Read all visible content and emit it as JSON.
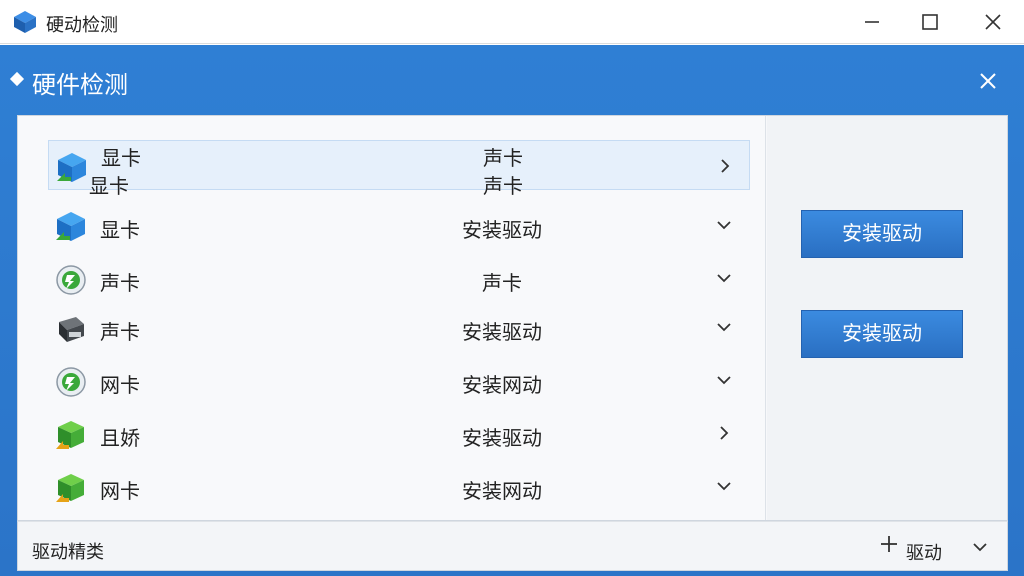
{
  "window": {
    "title": "硬动检测"
  },
  "dialog": {
    "title": "硬件检测"
  },
  "rows": [
    {
      "name": "显卡",
      "status": "安装驱动",
      "icon": "gpu-cube-icon"
    },
    {
      "name": "声卡",
      "status": "声卡",
      "icon": "audio-disc-icon"
    },
    {
      "name": "声卡",
      "status": "安装驱动",
      "icon": "device-box-icon"
    },
    {
      "name": "网卡",
      "status": "安装网动",
      "icon": "network-disc-icon"
    },
    {
      "name": "且娇",
      "status": "安装驱动",
      "icon": "green-cube-icon"
    },
    {
      "name": "网卡",
      "status": "安装网动",
      "icon": "green-cube-icon"
    }
  ],
  "selected_row": {
    "name_line1": "显卡",
    "name_line2": "显卡",
    "status_line1": "声卡",
    "status_line2": "声卡",
    "icon": "gpu-cube-icon"
  },
  "side_buttons": [
    "安装驱动",
    "安装驱动"
  ],
  "footer": {
    "label": "驱动精类",
    "action": "驱动"
  },
  "colors": {
    "accent": "#2b74c8",
    "button": "#2f7fd4"
  }
}
